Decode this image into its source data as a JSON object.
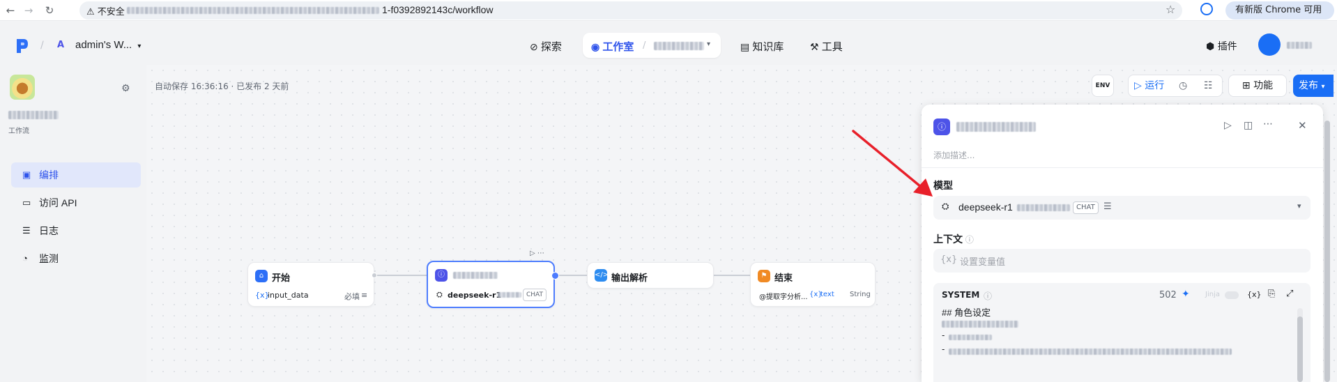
{
  "browser": {
    "insecure_label": "不安全",
    "url_tail": "1-f0392892143c/workflow",
    "update_label": "有新版 Chrome 可用"
  },
  "header": {
    "workspace_letter": "A",
    "workspace_name": "admin's W...",
    "nav": [
      {
        "label": "探索"
      },
      {
        "label": "工作室"
      },
      {
        "label": "知识库"
      },
      {
        "label": "工具"
      }
    ],
    "plugin_label": "插件"
  },
  "sidebar": {
    "subtitle": "工作流",
    "items": [
      {
        "label": "编排",
        "icon": "layout-icon",
        "active": true
      },
      {
        "label": "访问 API",
        "icon": "terminal-icon",
        "active": false
      },
      {
        "label": "日志",
        "icon": "log-icon",
        "active": false
      },
      {
        "label": "监测",
        "icon": "monitor-icon",
        "active": false
      }
    ]
  },
  "canvas": {
    "autosave": "自动保存 16:36:16 · 已发布 2 天前",
    "toolbar": {
      "env": "ENV",
      "run": "运行",
      "features": "功能",
      "publish": "发布"
    },
    "nodes": {
      "start": {
        "title": "开始",
        "var": "input_data",
        "required": "必填"
      },
      "llm": {
        "model": "deepseek-r1",
        "tag": "CHAT"
      },
      "parse": {
        "title": "输出解析"
      },
      "end": {
        "title": "结束",
        "var_prefix": "{x}",
        "var": "text",
        "type": "String",
        "source": "@提取字分析..."
      }
    }
  },
  "panel": {
    "desc_placeholder": "添加描述...",
    "model_label": "模型",
    "model_name": "deepseek-r1",
    "model_tag": "CHAT",
    "context_label": "上下文",
    "context_placeholder": "设置变量值",
    "system_label": "SYSTEM",
    "system_count": "502",
    "jinja_label": "Jinja",
    "system_heading": "## 角色设定"
  },
  "colors": {
    "accent": "#1a6ef5",
    "primary_indigo": "#4d53e8",
    "arrow_red": "#e8202a"
  }
}
